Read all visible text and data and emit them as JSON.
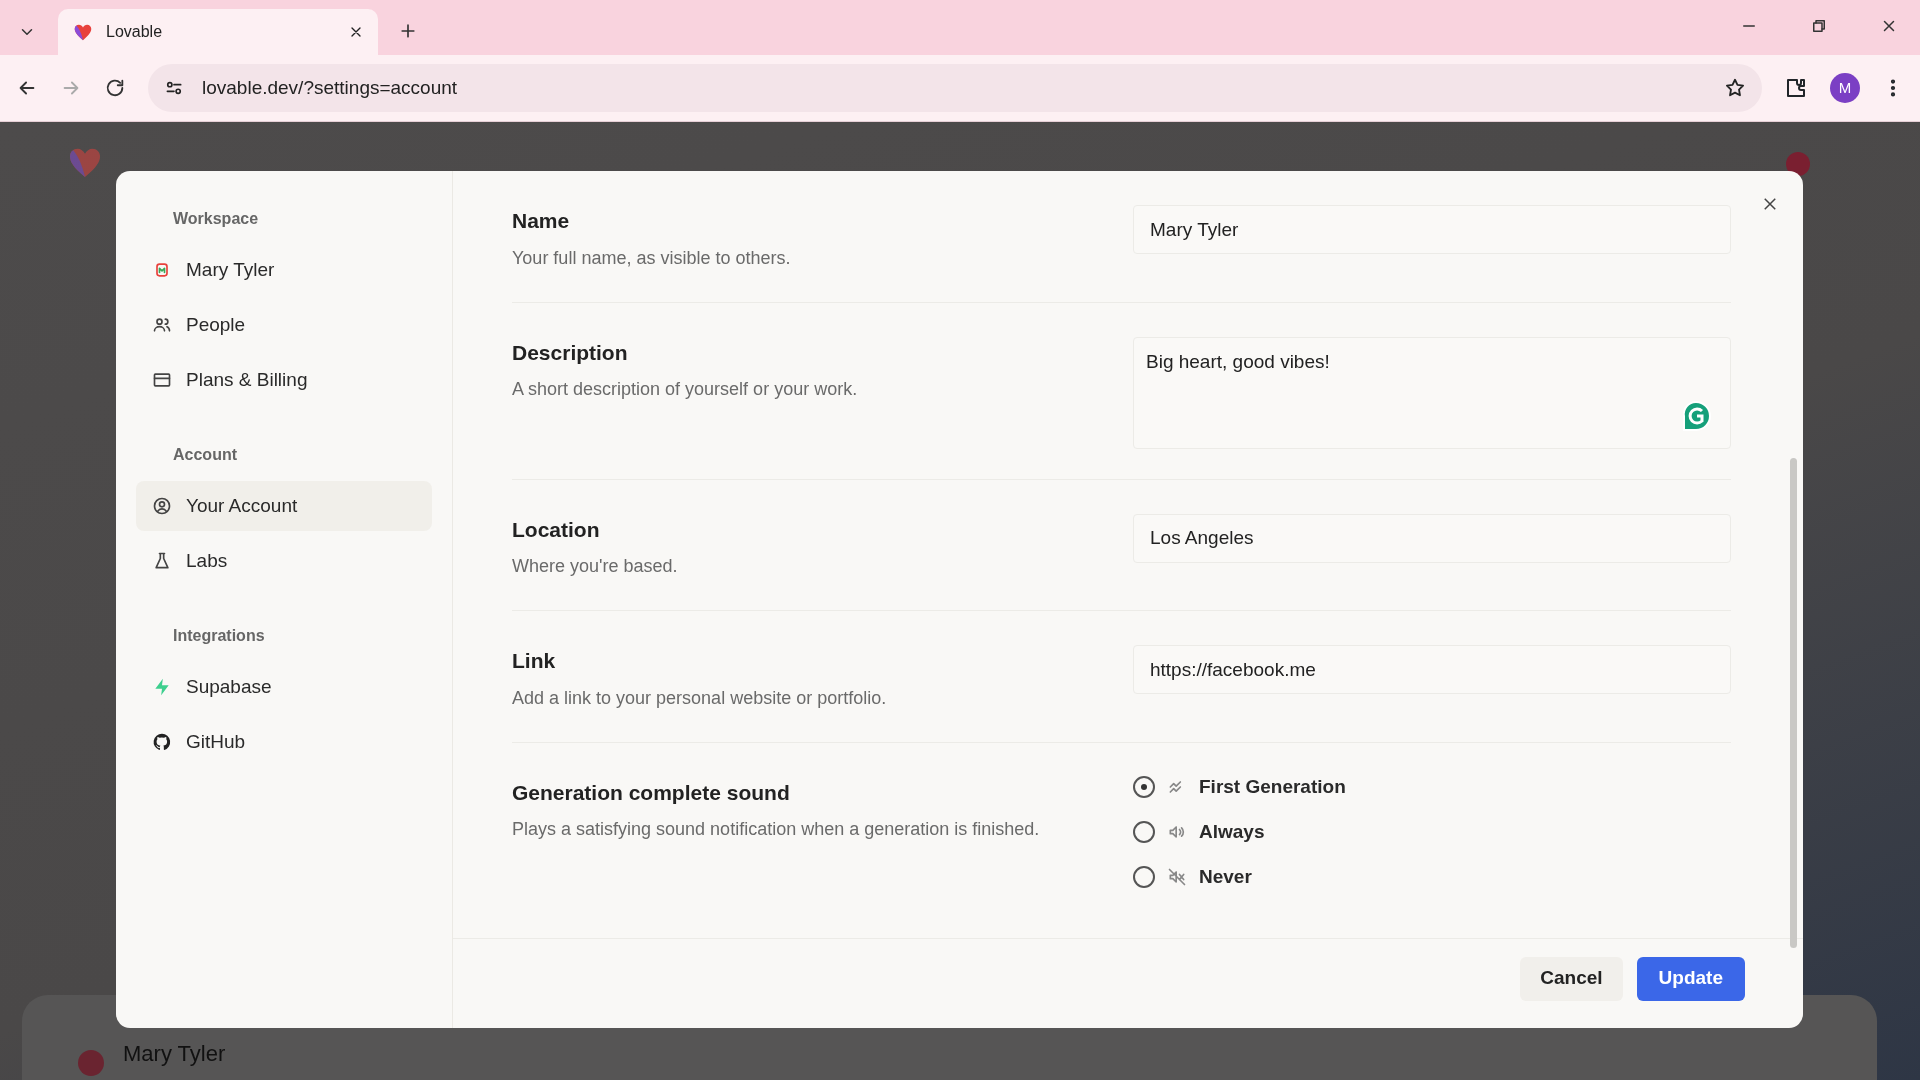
{
  "browser": {
    "tab_title": "Lovable",
    "url": "lovable.dev/?settings=account",
    "profile_initial": "M"
  },
  "background": {
    "card_title": "Mary Tyler"
  },
  "sidebar": [
    {
      "heading": "Workspace",
      "items": [
        {
          "label": "Mary Tyler",
          "selected": false
        },
        {
          "label": "People",
          "selected": false
        },
        {
          "label": "Plans & Billing",
          "selected": false
        }
      ]
    },
    {
      "heading": "Account",
      "items": [
        {
          "label": "Your Account",
          "selected": true
        },
        {
          "label": "Labs",
          "selected": false
        }
      ]
    },
    {
      "heading": "Integrations",
      "items": [
        {
          "label": "Supabase",
          "selected": false
        },
        {
          "label": "GitHub",
          "selected": false
        }
      ]
    }
  ],
  "fields": [
    {
      "kind": "input",
      "label": "Name",
      "help": "Your full name, as visible to others.",
      "value": "Mary Tyler"
    },
    {
      "kind": "textarea",
      "label": "Description",
      "help": "A short description of yourself or your work.",
      "value": "Big heart, good vibes!"
    },
    {
      "kind": "input",
      "label": "Location",
      "help": "Where you're based.",
      "value": "Los Angeles"
    },
    {
      "kind": "input",
      "label": "Link",
      "help": "Add a link to your personal website or portfolio.",
      "value": "https://facebook.me"
    },
    {
      "kind": "radio",
      "label": "Generation complete sound",
      "help": "Plays a satisfying sound notification when a generation is finished.",
      "options": [
        {
          "label": "First Generation",
          "selected": true
        },
        {
          "label": "Always",
          "selected": false
        },
        {
          "label": "Never",
          "selected": false
        }
      ]
    }
  ],
  "footer": {
    "buttons": [
      {
        "label": "Cancel",
        "kind": "secondary"
      },
      {
        "label": "Update",
        "kind": "primary"
      }
    ]
  }
}
